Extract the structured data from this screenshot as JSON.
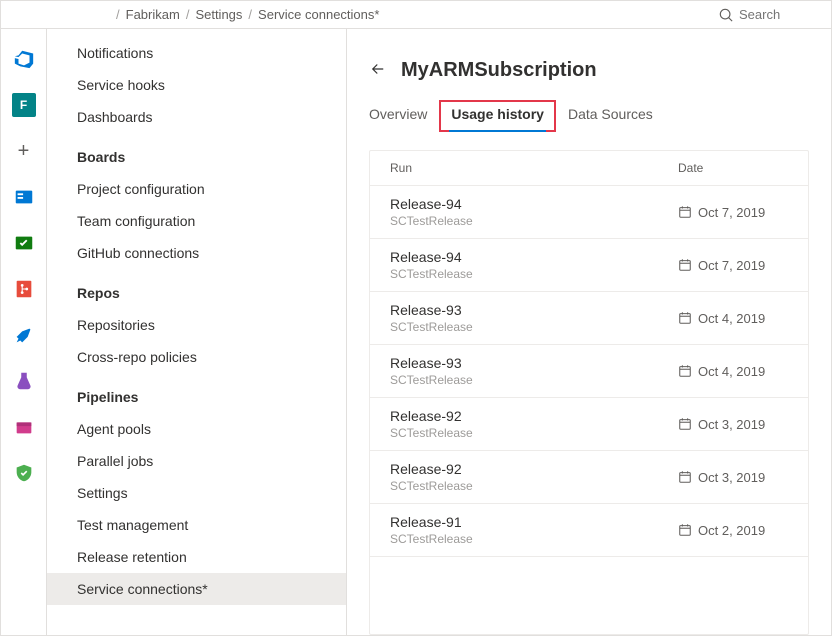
{
  "breadcrumb": [
    "Fabrikam",
    "Settings",
    "Service connections*"
  ],
  "search": {
    "placeholder": "Search"
  },
  "rail": {
    "avatar_letter": "F"
  },
  "sidebar": {
    "top_items": [
      "Notifications",
      "Service hooks",
      "Dashboards"
    ],
    "groups": [
      {
        "heading": "Boards",
        "items": [
          "Project configuration",
          "Team configuration",
          "GitHub connections"
        ]
      },
      {
        "heading": "Repos",
        "items": [
          "Repositories",
          "Cross-repo policies"
        ]
      },
      {
        "heading": "Pipelines",
        "items": [
          "Agent pools",
          "Parallel jobs",
          "Settings",
          "Test management",
          "Release retention",
          "Service connections*"
        ]
      }
    ],
    "active_item": "Service connections*"
  },
  "main": {
    "title": "MyARMSubscription",
    "tabs": [
      "Overview",
      "Usage history",
      "Data Sources"
    ],
    "active_tab": "Usage history",
    "table": {
      "columns": {
        "run": "Run",
        "date": "Date"
      },
      "rows": [
        {
          "name": "Release-94",
          "sub": "SCTestRelease",
          "date": "Oct 7, 2019"
        },
        {
          "name": "Release-94",
          "sub": "SCTestRelease",
          "date": "Oct 7, 2019"
        },
        {
          "name": "Release-93",
          "sub": "SCTestRelease",
          "date": "Oct 4, 2019"
        },
        {
          "name": "Release-93",
          "sub": "SCTestRelease",
          "date": "Oct 4, 2019"
        },
        {
          "name": "Release-92",
          "sub": "SCTestRelease",
          "date": "Oct 3, 2019"
        },
        {
          "name": "Release-92",
          "sub": "SCTestRelease",
          "date": "Oct 3, 2019"
        },
        {
          "name": "Release-91",
          "sub": "SCTestRelease",
          "date": "Oct 2, 2019"
        }
      ]
    }
  }
}
